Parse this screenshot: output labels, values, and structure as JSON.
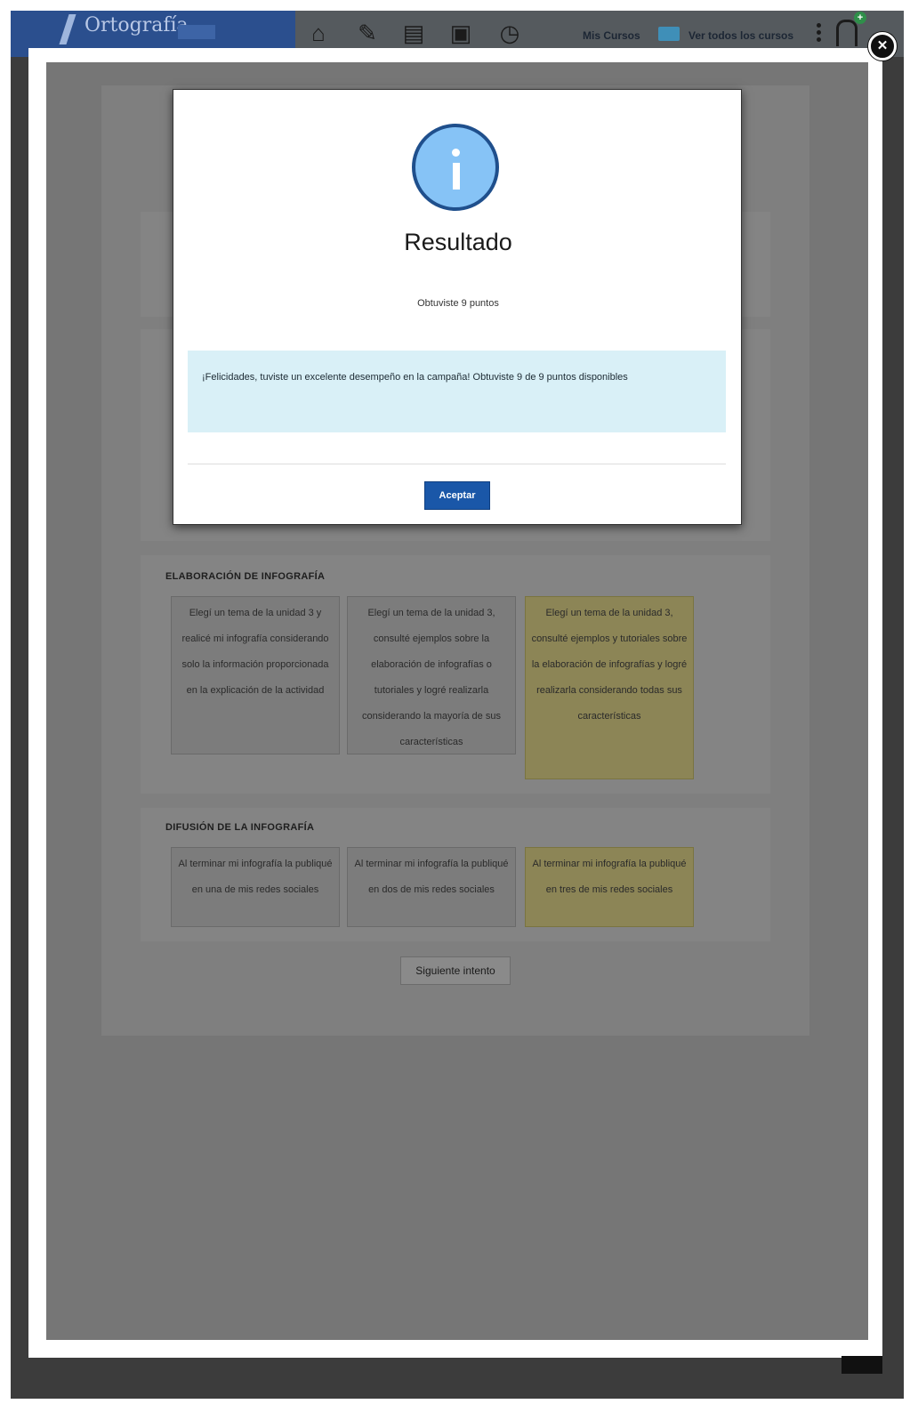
{
  "topbar": {
    "brand_name": "Ortografía",
    "nav_icons": [
      "home-icon",
      "edit-icon",
      "document-icon",
      "chat-icon",
      "clock-icon"
    ],
    "my_courses_label": "Mis Cursos",
    "all_courses_label": "Ver todos los cursos"
  },
  "page": {
    "sections": [
      {
        "title": "ELABORACIÓN DE INFOGRAFÍA",
        "options": [
          "Elegí un tema de la unidad 3 y realicé mi infografía considerando solo la información proporcionada en la explicación de la actividad",
          "Elegí un tema de la unidad 3, consulté ejemplos sobre la elaboración de infografías o tutoriales y logré realizarla considerando la mayoría de sus características",
          "Elegí un tema de la unidad 3, consulté ejemplos y tutoriales sobre la elaboración de infografías y logré realizarla considerando todas sus características"
        ],
        "selected_index": 2
      },
      {
        "title": "DIFUSIÓN DE LA INFOGRAFÍA",
        "options": [
          "Al terminar mi infografía la publiqué en una de mis redes sociales",
          "Al terminar mi infografía la publiqué en dos de mis redes sociales",
          "Al terminar mi infografía la publiqué en tres de mis redes sociales"
        ],
        "selected_index": 2
      }
    ],
    "next_button_label": "Siguiente intento"
  },
  "modal": {
    "icon": "info-icon",
    "title": "Resultado",
    "points_text": "Obtuviste 9 puntos",
    "alert_text": "¡Felicidades, tuviste un excelente desempeño en la campaña! Obtuviste 9 de 9 puntos disponibles",
    "accept_label": "Aceptar"
  },
  "lightbox": {
    "close_icon": "close-icon"
  },
  "colors": {
    "brand": "#2b4f8e",
    "accept_button": "#1a57a8",
    "info_icon": "#86c3f6",
    "alert_bg": "#d9f0f7",
    "selected_cell": "#8c8556"
  }
}
